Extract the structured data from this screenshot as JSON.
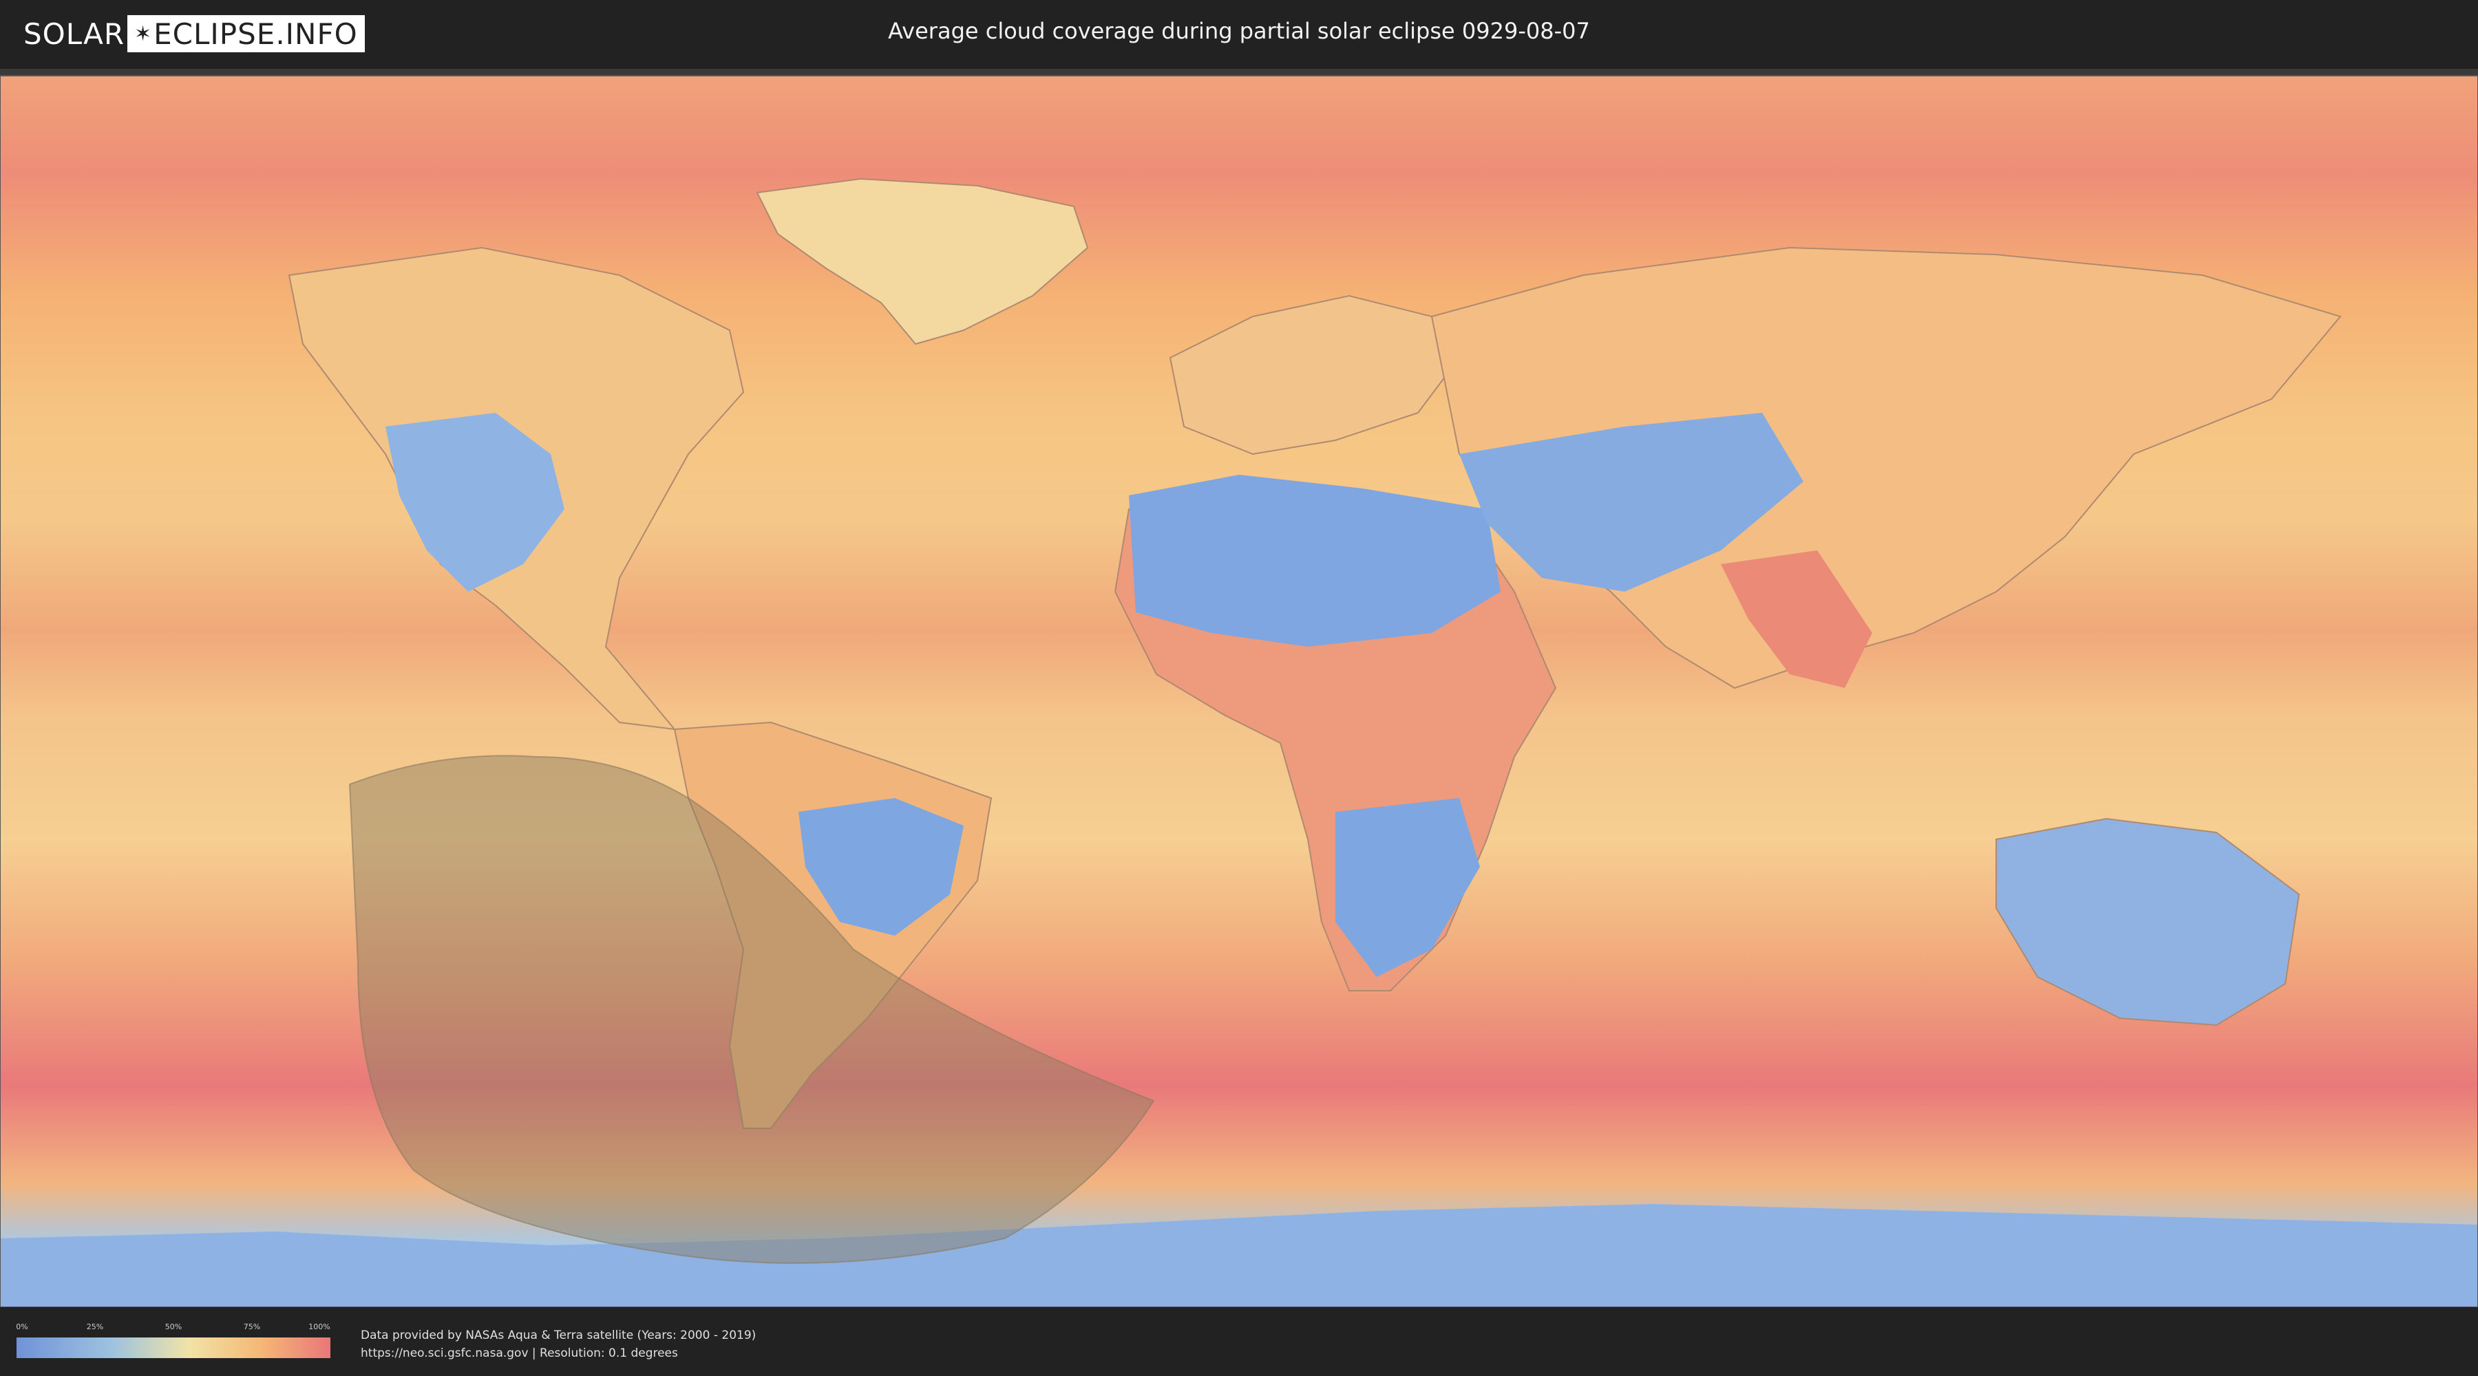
{
  "header": {
    "logo_left": "SOLAR",
    "logo_right": "ECLIPSE.INFO",
    "title": "Average cloud coverage during partial solar eclipse 0929-08-07"
  },
  "legend": {
    "ticks": [
      "0%",
      "25%",
      "50%",
      "75%",
      "100%"
    ],
    "gradient_colors": [
      "#6f93d8",
      "#9cc2e0",
      "#f1e3a6",
      "#f5b775",
      "#e9777a"
    ]
  },
  "credits": {
    "line1": "Data provided by NASAs Aqua & Terra satellite (Years: 2000 - 2019)",
    "line2": "https://neo.sci.gsfc.nasa.gov | Resolution: 0.1 degrees"
  },
  "colors": {
    "clear": "#7ea6e0",
    "low": "#a9c9e6",
    "mid": "#f3dc9c",
    "high": "#f4b176",
    "overcast": "#ea8579",
    "eclipse_shade": "#8a7a60"
  }
}
